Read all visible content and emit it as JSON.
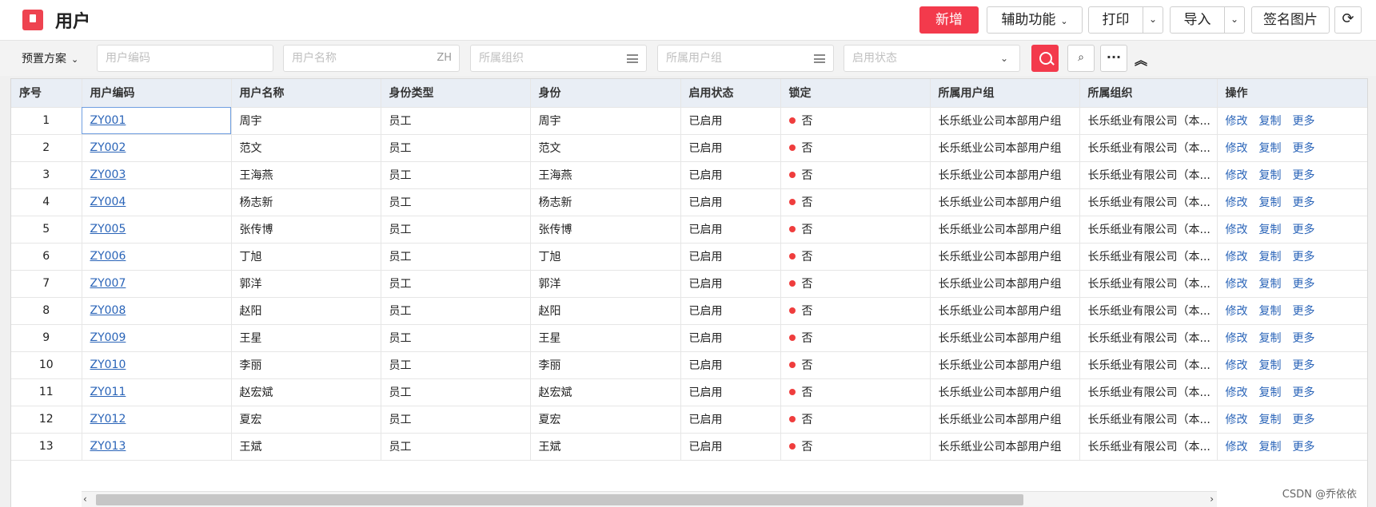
{
  "header": {
    "title": "用户",
    "buttons": {
      "add": "新增",
      "assist": "辅助功能",
      "print": "打印",
      "import": "导入",
      "signature": "签名图片"
    }
  },
  "filters": {
    "preset_label": "预置方案",
    "user_code_placeholder": "用户编码",
    "user_name_placeholder": "用户名称",
    "user_name_suffix": "ZH",
    "org_placeholder": "所属组织",
    "group_placeholder": "所属用户组",
    "status_placeholder": "启用状态"
  },
  "table": {
    "columns": [
      "序号",
      "用户编码",
      "用户名称",
      "身份类型",
      "身份",
      "启用状态",
      "锁定",
      "所属用户组",
      "所属组织",
      "操作"
    ],
    "rows": [
      {
        "no": "1",
        "code": "ZY001",
        "name": "周宇",
        "type": "员工",
        "identity": "周宇",
        "status": "已启用",
        "locked": "否",
        "group": "长乐纸业公司本部用户组",
        "org": "长乐纸业有限公司（本..."
      },
      {
        "no": "2",
        "code": "ZY002",
        "name": "范文",
        "type": "员工",
        "identity": "范文",
        "status": "已启用",
        "locked": "否",
        "group": "长乐纸业公司本部用户组",
        "org": "长乐纸业有限公司（本..."
      },
      {
        "no": "3",
        "code": "ZY003",
        "name": "王海燕",
        "type": "员工",
        "identity": "王海燕",
        "status": "已启用",
        "locked": "否",
        "group": "长乐纸业公司本部用户组",
        "org": "长乐纸业有限公司（本..."
      },
      {
        "no": "4",
        "code": "ZY004",
        "name": "杨志新",
        "type": "员工",
        "identity": "杨志新",
        "status": "已启用",
        "locked": "否",
        "group": "长乐纸业公司本部用户组",
        "org": "长乐纸业有限公司（本..."
      },
      {
        "no": "5",
        "code": "ZY005",
        "name": "张传博",
        "type": "员工",
        "identity": "张传博",
        "status": "已启用",
        "locked": "否",
        "group": "长乐纸业公司本部用户组",
        "org": "长乐纸业有限公司（本..."
      },
      {
        "no": "6",
        "code": "ZY006",
        "name": "丁旭",
        "type": "员工",
        "identity": "丁旭",
        "status": "已启用",
        "locked": "否",
        "group": "长乐纸业公司本部用户组",
        "org": "长乐纸业有限公司（本..."
      },
      {
        "no": "7",
        "code": "ZY007",
        "name": "郭洋",
        "type": "员工",
        "identity": "郭洋",
        "status": "已启用",
        "locked": "否",
        "group": "长乐纸业公司本部用户组",
        "org": "长乐纸业有限公司（本..."
      },
      {
        "no": "8",
        "code": "ZY008",
        "name": "赵阳",
        "type": "员工",
        "identity": "赵阳",
        "status": "已启用",
        "locked": "否",
        "group": "长乐纸业公司本部用户组",
        "org": "长乐纸业有限公司（本..."
      },
      {
        "no": "9",
        "code": "ZY009",
        "name": "王星",
        "type": "员工",
        "identity": "王星",
        "status": "已启用",
        "locked": "否",
        "group": "长乐纸业公司本部用户组",
        "org": "长乐纸业有限公司（本..."
      },
      {
        "no": "10",
        "code": "ZY010",
        "name": "李丽",
        "type": "员工",
        "identity": "李丽",
        "status": "已启用",
        "locked": "否",
        "group": "长乐纸业公司本部用户组",
        "org": "长乐纸业有限公司（本..."
      },
      {
        "no": "11",
        "code": "ZY011",
        "name": "赵宏斌",
        "type": "员工",
        "identity": "赵宏斌",
        "status": "已启用",
        "locked": "否",
        "group": "长乐纸业公司本部用户组",
        "org": "长乐纸业有限公司（本..."
      },
      {
        "no": "12",
        "code": "ZY012",
        "name": "夏宏",
        "type": "员工",
        "identity": "夏宏",
        "status": "已启用",
        "locked": "否",
        "group": "长乐纸业公司本部用户组",
        "org": "长乐纸业有限公司（本..."
      },
      {
        "no": "13",
        "code": "ZY013",
        "name": "王斌",
        "type": "员工",
        "identity": "王斌",
        "status": "已启用",
        "locked": "否",
        "group": "长乐纸业公司本部用户组",
        "org": "长乐纸业有限公司（本..."
      }
    ],
    "actions": [
      "修改",
      "复制",
      "更多"
    ]
  },
  "watermark": "CSDN @乔依依",
  "icons": {
    "app": "app-icon",
    "refresh": "refresh-icon",
    "search": "search-icon",
    "advanced_search": "filter-detail-icon",
    "more": "ellipsis-icon",
    "collapse": "double-chevron-up-icon"
  },
  "colors": {
    "primary": "#f33a4c",
    "link": "#2a64b8",
    "header_bg": "#e9eef5",
    "lock_dot": "#ef3d3d"
  }
}
